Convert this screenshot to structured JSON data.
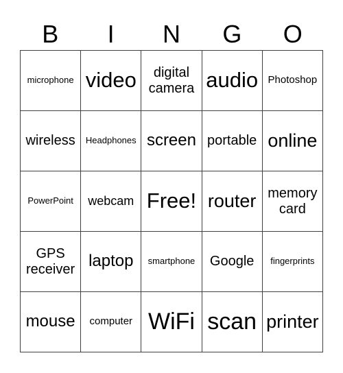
{
  "header": [
    "B",
    "I",
    "N",
    "G",
    "O"
  ],
  "rows": [
    [
      "microphone",
      "video",
      "digital camera",
      "audio",
      "Photoshop"
    ],
    [
      "wireless",
      "Headphones",
      "screen",
      "portable",
      "online"
    ],
    [
      "PowerPoint",
      "webcam",
      "Free!",
      "router",
      "memory card"
    ],
    [
      "GPS receiver",
      "laptop",
      "smartphone",
      "Google",
      "fingerprints"
    ],
    [
      "mouse",
      "computer",
      "WiFi",
      "scan",
      "printer"
    ]
  ]
}
